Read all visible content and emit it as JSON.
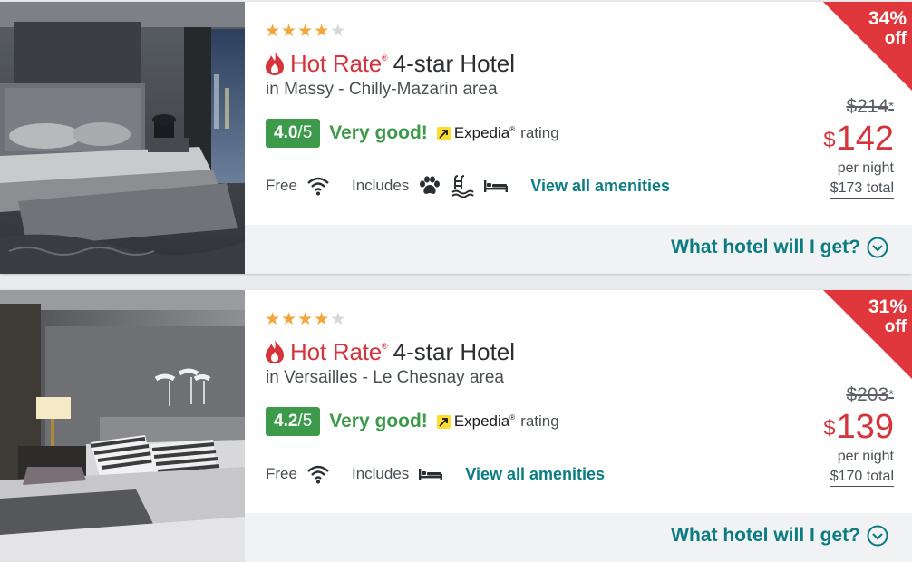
{
  "listings": [
    {
      "stars_filled": 4,
      "stars_total": 5,
      "badge": "Hot Rate",
      "badge_tm": "®",
      "title": "4-star Hotel",
      "location": "in Massy - Chilly-Mazarin area",
      "score": "4.0",
      "score_den": "/5",
      "verbal": "Very good!",
      "provider": "Expedia",
      "provider_tm": "®",
      "rating_word": "rating",
      "free_label": "Free",
      "includes_label": "Includes",
      "amenity_icons": [
        "wifi-icon",
        "pet-icon",
        "pool-icon",
        "bed-icon"
      ],
      "view_all": "View all amenities",
      "discount_pct": "34%",
      "discount_off": "off",
      "original_price": "$214",
      "original_mark": "*",
      "currency": "$",
      "price": "142",
      "per_night": "per night",
      "total": "$173 total",
      "what_hotel": "What hotel will I get?"
    },
    {
      "stars_filled": 4,
      "stars_total": 5,
      "badge": "Hot Rate",
      "badge_tm": "®",
      "title": "4-star Hotel",
      "location": "in Versailles - Le Chesnay area",
      "score": "4.2",
      "score_den": "/5",
      "verbal": "Very good!",
      "provider": "Expedia",
      "provider_tm": "®",
      "rating_word": "rating",
      "free_label": "Free",
      "includes_label": "Includes",
      "amenity_icons": [
        "wifi-icon",
        "bed-icon"
      ],
      "view_all": "View all amenities",
      "discount_pct": "31%",
      "discount_off": "off",
      "original_price": "$203",
      "original_mark": "*",
      "currency": "$",
      "price": "139",
      "per_night": "per night",
      "total": "$170 total",
      "what_hotel": "What hotel will I get?"
    }
  ],
  "colors": {
    "hot_rate_red": "#d6343c",
    "rating_green": "#3d9a4b",
    "link_teal": "#0b7d82",
    "star_gold": "#f2a63a",
    "expedia_yellow": "#fddb32"
  }
}
